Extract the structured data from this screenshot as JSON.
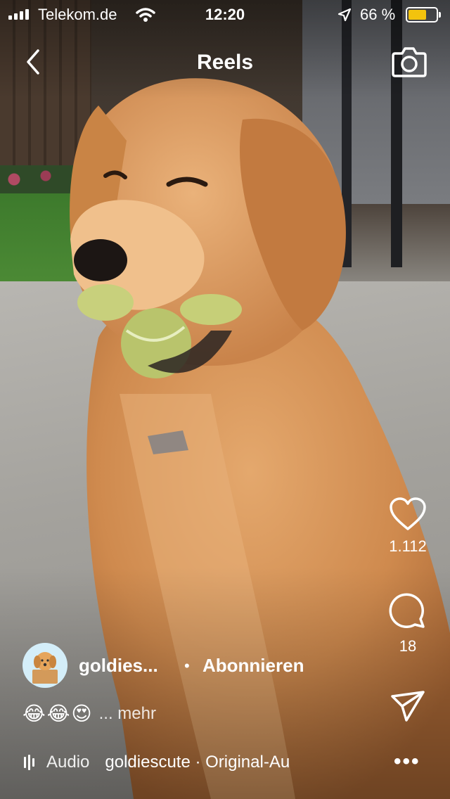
{
  "status_bar": {
    "carrier": "Telekom.de",
    "time": "12:20",
    "battery_percent": "66 %",
    "battery_level": 0.66,
    "icons": [
      "signal-icon",
      "wifi-icon",
      "location-arrow-icon",
      "battery-icon"
    ]
  },
  "header": {
    "title": "Reels",
    "icons": [
      "chevron-left-icon",
      "camera-icon"
    ]
  },
  "actions": {
    "like_count": "1.112",
    "comment_count": "18",
    "icons": [
      "heart-icon",
      "comment-icon",
      "send-icon"
    ]
  },
  "post": {
    "username": "goldies...",
    "separator": "•",
    "follow_label": "Abonnieren",
    "caption_emojis": "😂😂😍",
    "more_label": "... mehr",
    "audio_label": "Audio",
    "audio_track": "goldiescute · Original-Au",
    "options_label": "•••"
  },
  "colors": {
    "battery": "#f3c30d",
    "text": "#ffffff"
  }
}
